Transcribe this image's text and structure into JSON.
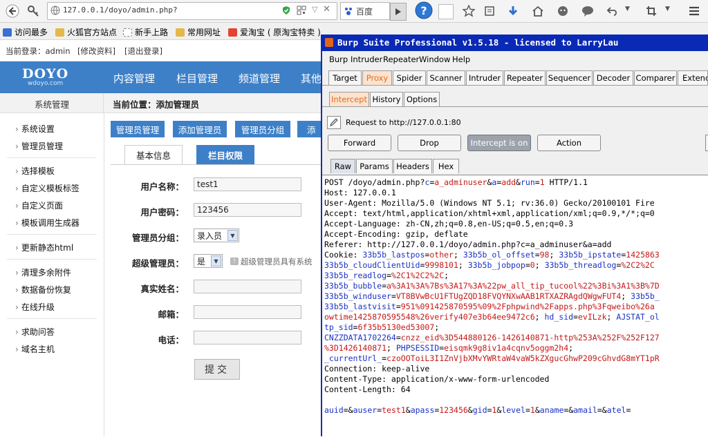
{
  "browser": {
    "url": "127.0.0.1/doyo/admin.php?",
    "search_engine": "百度",
    "bookmarks": [
      {
        "label": "访问最多",
        "color": "#3b6fd1"
      },
      {
        "label": "火狐官方站点",
        "color": "#e5b84a"
      },
      {
        "label": "新手上路",
        "color": "#d8d8d8"
      },
      {
        "label": "常用网址",
        "color": "#e5b84a"
      },
      {
        "label": "爱淘宝 ( 原淘宝特卖 )",
        "color": "#e4432f"
      }
    ]
  },
  "admin": {
    "login": {
      "current_user": "当前登录：admin",
      "edit_profile": "[修改资料]",
      "logout": "[退出登录]"
    },
    "logo": {
      "main": "DOYO",
      "sub": "wdoyo.com"
    },
    "nav": [
      "内容管理",
      "栏目管理",
      "频道管理",
      "其他"
    ],
    "side_heading": "系统管理",
    "location": "当前位置：添加管理员",
    "sidebar_groups": [
      [
        "系统设置",
        "管理员管理"
      ],
      [
        "选择模板",
        "自定义模板标签",
        "自定义页面",
        "模板调用生成器"
      ],
      [
        "更新静态html"
      ],
      [
        "清理多余附件",
        "数据备份恢复",
        "在线升级"
      ],
      [
        "求助问答",
        "域名主机"
      ]
    ],
    "actions": [
      "管理员管理",
      "添加管理员",
      "管理员分组",
      "添"
    ],
    "tabs": [
      "基本信息",
      "栏目权限"
    ],
    "form": {
      "username_label": "用户名称：",
      "username": "test1",
      "password_label": "用户密码：",
      "password": "123456",
      "group_label": "管理员分组：",
      "group": "录入员",
      "super_label": "超级管理员：",
      "super": "是",
      "super_hint": "超级管理员具有系统",
      "realname_label": "真实姓名：",
      "email_label": "邮箱：",
      "phone_label": "电话：",
      "submit": "提交"
    }
  },
  "burp": {
    "title": "Burp Suite Professional v1.5.18 - licensed to LarryLau",
    "menu": [
      "Burp",
      "Intruder",
      "Repeater",
      "Window",
      "Help"
    ],
    "tabs": [
      "Target",
      "Proxy",
      "Spider",
      "Scanner",
      "Intruder",
      "Repeater",
      "Sequencer",
      "Decoder",
      "Comparer",
      "Extende"
    ],
    "subtabs": [
      "Intercept",
      "History",
      "Options"
    ],
    "request_to": "Request to http://127.0.0.1:80",
    "buttons": {
      "forward": "Forward",
      "drop": "Drop",
      "intercept": "Intercept is on",
      "action": "Action"
    },
    "view_tabs": [
      "Raw",
      "Params",
      "Headers",
      "Hex"
    ],
    "request_lines": [
      [
        [
          "POST /doyo/admin.php?",
          "n"
        ],
        [
          "c",
          "k"
        ],
        [
          "=",
          "n"
        ],
        [
          "a_adminuser",
          "v"
        ],
        [
          "&",
          "n"
        ],
        [
          "a",
          "k"
        ],
        [
          "=",
          "n"
        ],
        [
          "add",
          "v"
        ],
        [
          "&",
          "n"
        ],
        [
          "run",
          "k"
        ],
        [
          "=",
          "n"
        ],
        [
          "1",
          "v"
        ],
        [
          " HTTP/1.1",
          "n"
        ]
      ],
      [
        [
          "Host: 127.0.0.1",
          "n"
        ]
      ],
      [
        [
          "User-Agent: Mozilla/5.0 (Windows NT 5.1; rv:36.0) Gecko/20100101 Fire",
          "n"
        ]
      ],
      [
        [
          "Accept: text/html,application/xhtml+xml,application/xml;q=0.9,*/*;q=0",
          "n"
        ]
      ],
      [
        [
          "Accept-Language: zh-CN,zh;q=0.8,en-US;q=0.5,en;q=0.3",
          "n"
        ]
      ],
      [
        [
          "Accept-Encoding: gzip, deflate",
          "n"
        ]
      ],
      [
        [
          "Referer: http://127.0.0.1/doyo/admin.php?c=a_adminuser&a=add",
          "n"
        ]
      ],
      [
        [
          "Cookie: ",
          "n"
        ],
        [
          "33b5b_lastpos",
          "k"
        ],
        [
          "=",
          "n"
        ],
        [
          "other",
          "v"
        ],
        [
          "; ",
          "n"
        ],
        [
          "33b5b_ol_offset",
          "k"
        ],
        [
          "=",
          "n"
        ],
        [
          "98",
          "v"
        ],
        [
          "; ",
          "n"
        ],
        [
          "33b5b_ipstate",
          "k"
        ],
        [
          "=",
          "n"
        ],
        [
          "1425863",
          "v"
        ]
      ],
      [
        [
          "33b5b_cloudClientUid",
          "k"
        ],
        [
          "=",
          "n"
        ],
        [
          "9998101",
          "v"
        ],
        [
          "; ",
          "n"
        ],
        [
          "33b5b_jobpop",
          "k"
        ],
        [
          "=",
          "n"
        ],
        [
          "0",
          "v"
        ],
        [
          "; ",
          "n"
        ],
        [
          "33b5b_threadlog",
          "k"
        ],
        [
          "=",
          "n"
        ],
        [
          "%2C2%2C",
          "v"
        ]
      ],
      [
        [
          "33b5b_readlog",
          "k"
        ],
        [
          "=",
          "n"
        ],
        [
          "%2C1%2C2%2C",
          "v"
        ],
        [
          ";",
          "n"
        ]
      ],
      [
        [
          "33b5b_bubble",
          "k"
        ],
        [
          "=",
          "n"
        ],
        [
          "a%3A1%3A%7Bs%3A17%3A%22pw_all_tip_tucool%22%3Bi%3A1%3B%7D",
          "v"
        ]
      ],
      [
        [
          "33b5b_winduser",
          "k"
        ],
        [
          "=",
          "n"
        ],
        [
          "VT8BVwBcU1FTUgZQD18FVQYNXwAAB1RTXAZRAgdQWgwFUT4",
          "v"
        ],
        [
          "; ",
          "n"
        ],
        [
          "33b5b_",
          "k"
        ]
      ],
      [
        [
          "33b5b_lastvisit",
          "k"
        ],
        [
          "=",
          "n"
        ],
        [
          "951%091425870595%09%2Fphpwind%2Fapps.php%3Fqweibo%26a",
          "v"
        ]
      ],
      [
        [
          "owtime1425870595548%26verify407e3b64ee9472c6",
          "v"
        ],
        [
          "; ",
          "n"
        ],
        [
          "hd_sid",
          "k"
        ],
        [
          "=",
          "n"
        ],
        [
          "evILzk",
          "v"
        ],
        [
          "; ",
          "n"
        ],
        [
          "AJSTAT_ol",
          "k"
        ]
      ],
      [
        [
          "tp_sid",
          "k"
        ],
        [
          "=",
          "n"
        ],
        [
          "6f35b5130ed53007",
          "v"
        ],
        [
          ";",
          "n"
        ]
      ],
      [
        [
          "CNZZDATA1702264",
          "k"
        ],
        [
          "=",
          "n"
        ],
        [
          "cnzz_eid%3D544880126-1426140871-http%253A%252F%252F127",
          "v"
        ]
      ],
      [
        [
          "%3D1426140871",
          "v"
        ],
        [
          "; ",
          "n"
        ],
        [
          "PHPSESSID",
          "k"
        ],
        [
          "=",
          "n"
        ],
        [
          "eisqmk9g8iv1a4cqnv5oggm2h4",
          "v"
        ],
        [
          ";",
          "n"
        ]
      ],
      [
        [
          "_currentUrl_",
          "k"
        ],
        [
          "=",
          "n"
        ],
        [
          "czoOOToiL3I1ZnVjbXMvYWRtaW4vaW5kZXgucGhwP209cGhvdG8mYT1pR",
          "v"
        ]
      ],
      [
        [
          "Connection: keep-alive",
          "n"
        ]
      ],
      [
        [
          "Content-Type: application/x-www-form-urlencoded",
          "n"
        ]
      ],
      [
        [
          "Content-Length: 64",
          "n"
        ]
      ],
      [
        [
          "",
          "n"
        ]
      ],
      [
        [
          "auid",
          "k"
        ],
        [
          "=&",
          "n"
        ],
        [
          "auser",
          "k"
        ],
        [
          "=",
          "n"
        ],
        [
          "test1",
          "v"
        ],
        [
          "&",
          "n"
        ],
        [
          "apass",
          "k"
        ],
        [
          "=",
          "n"
        ],
        [
          "123456",
          "v"
        ],
        [
          "&",
          "n"
        ],
        [
          "gid",
          "k"
        ],
        [
          "=",
          "n"
        ],
        [
          "1",
          "v"
        ],
        [
          "&",
          "n"
        ],
        [
          "level",
          "k"
        ],
        [
          "=",
          "n"
        ],
        [
          "1",
          "v"
        ],
        [
          "&",
          "n"
        ],
        [
          "aname",
          "k"
        ],
        [
          "=&",
          "n"
        ],
        [
          "amail",
          "k"
        ],
        [
          "=&",
          "n"
        ],
        [
          "atel",
          "k"
        ],
        [
          "=",
          "n"
        ]
      ]
    ]
  }
}
